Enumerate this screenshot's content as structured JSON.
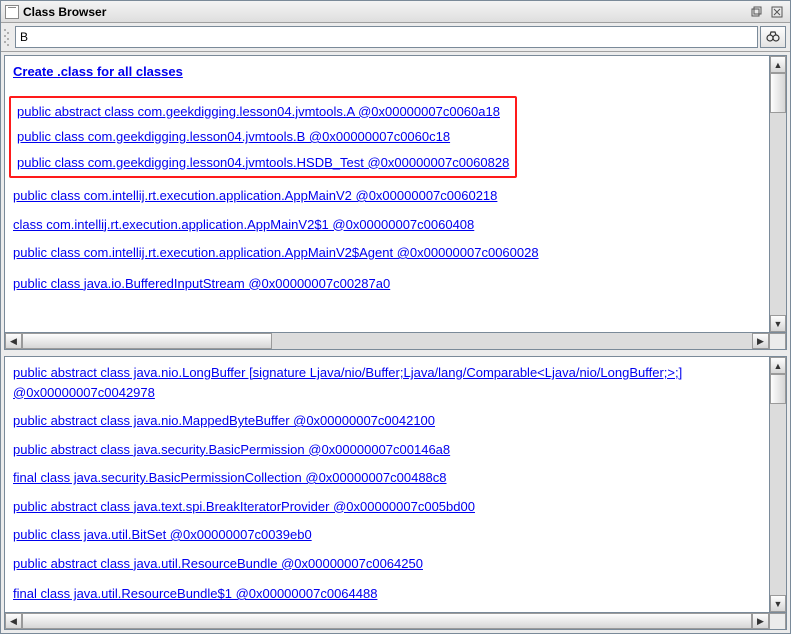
{
  "window": {
    "title": "Class Browser"
  },
  "search": {
    "value": "B"
  },
  "top_pane": {
    "create_link": "Create .class for all classes",
    "highlighted": [
      "public abstract class com.geekdigging.lesson04.jvmtools.A @0x00000007c0060a18",
      "public class com.geekdigging.lesson04.jvmtools.B @0x00000007c0060c18",
      "public class com.geekdigging.lesson04.jvmtools.HSDB_Test @0x00000007c0060828"
    ],
    "items": [
      "public class com.intellij.rt.execution.application.AppMainV2 @0x00000007c0060218",
      "class com.intellij.rt.execution.application.AppMainV2$1 @0x00000007c0060408",
      "public class com.intellij.rt.execution.application.AppMainV2$Agent @0x00000007c0060028",
      "public class java.io.BufferedInputStream @0x00000007c00287a0"
    ]
  },
  "bottom_pane": {
    "items": [
      "public abstract class java.nio.LongBuffer [signature Ljava/nio/Buffer;Ljava/lang/Comparable<Ljava/nio/LongBuffer;>;] @0x00000007c0042978",
      "public abstract class java.nio.MappedByteBuffer @0x00000007c0042100",
      "public abstract class java.security.BasicPermission @0x00000007c00146a8",
      "final class java.security.BasicPermissionCollection @0x00000007c00488c8",
      "public abstract class java.text.spi.BreakIteratorProvider @0x00000007c005bd00",
      "public class java.util.BitSet @0x00000007c0039eb0",
      "public abstract class java.util.ResourceBundle @0x00000007c0064250",
      "final class java.util.ResourceBundle$1 @0x00000007c0064488"
    ]
  }
}
